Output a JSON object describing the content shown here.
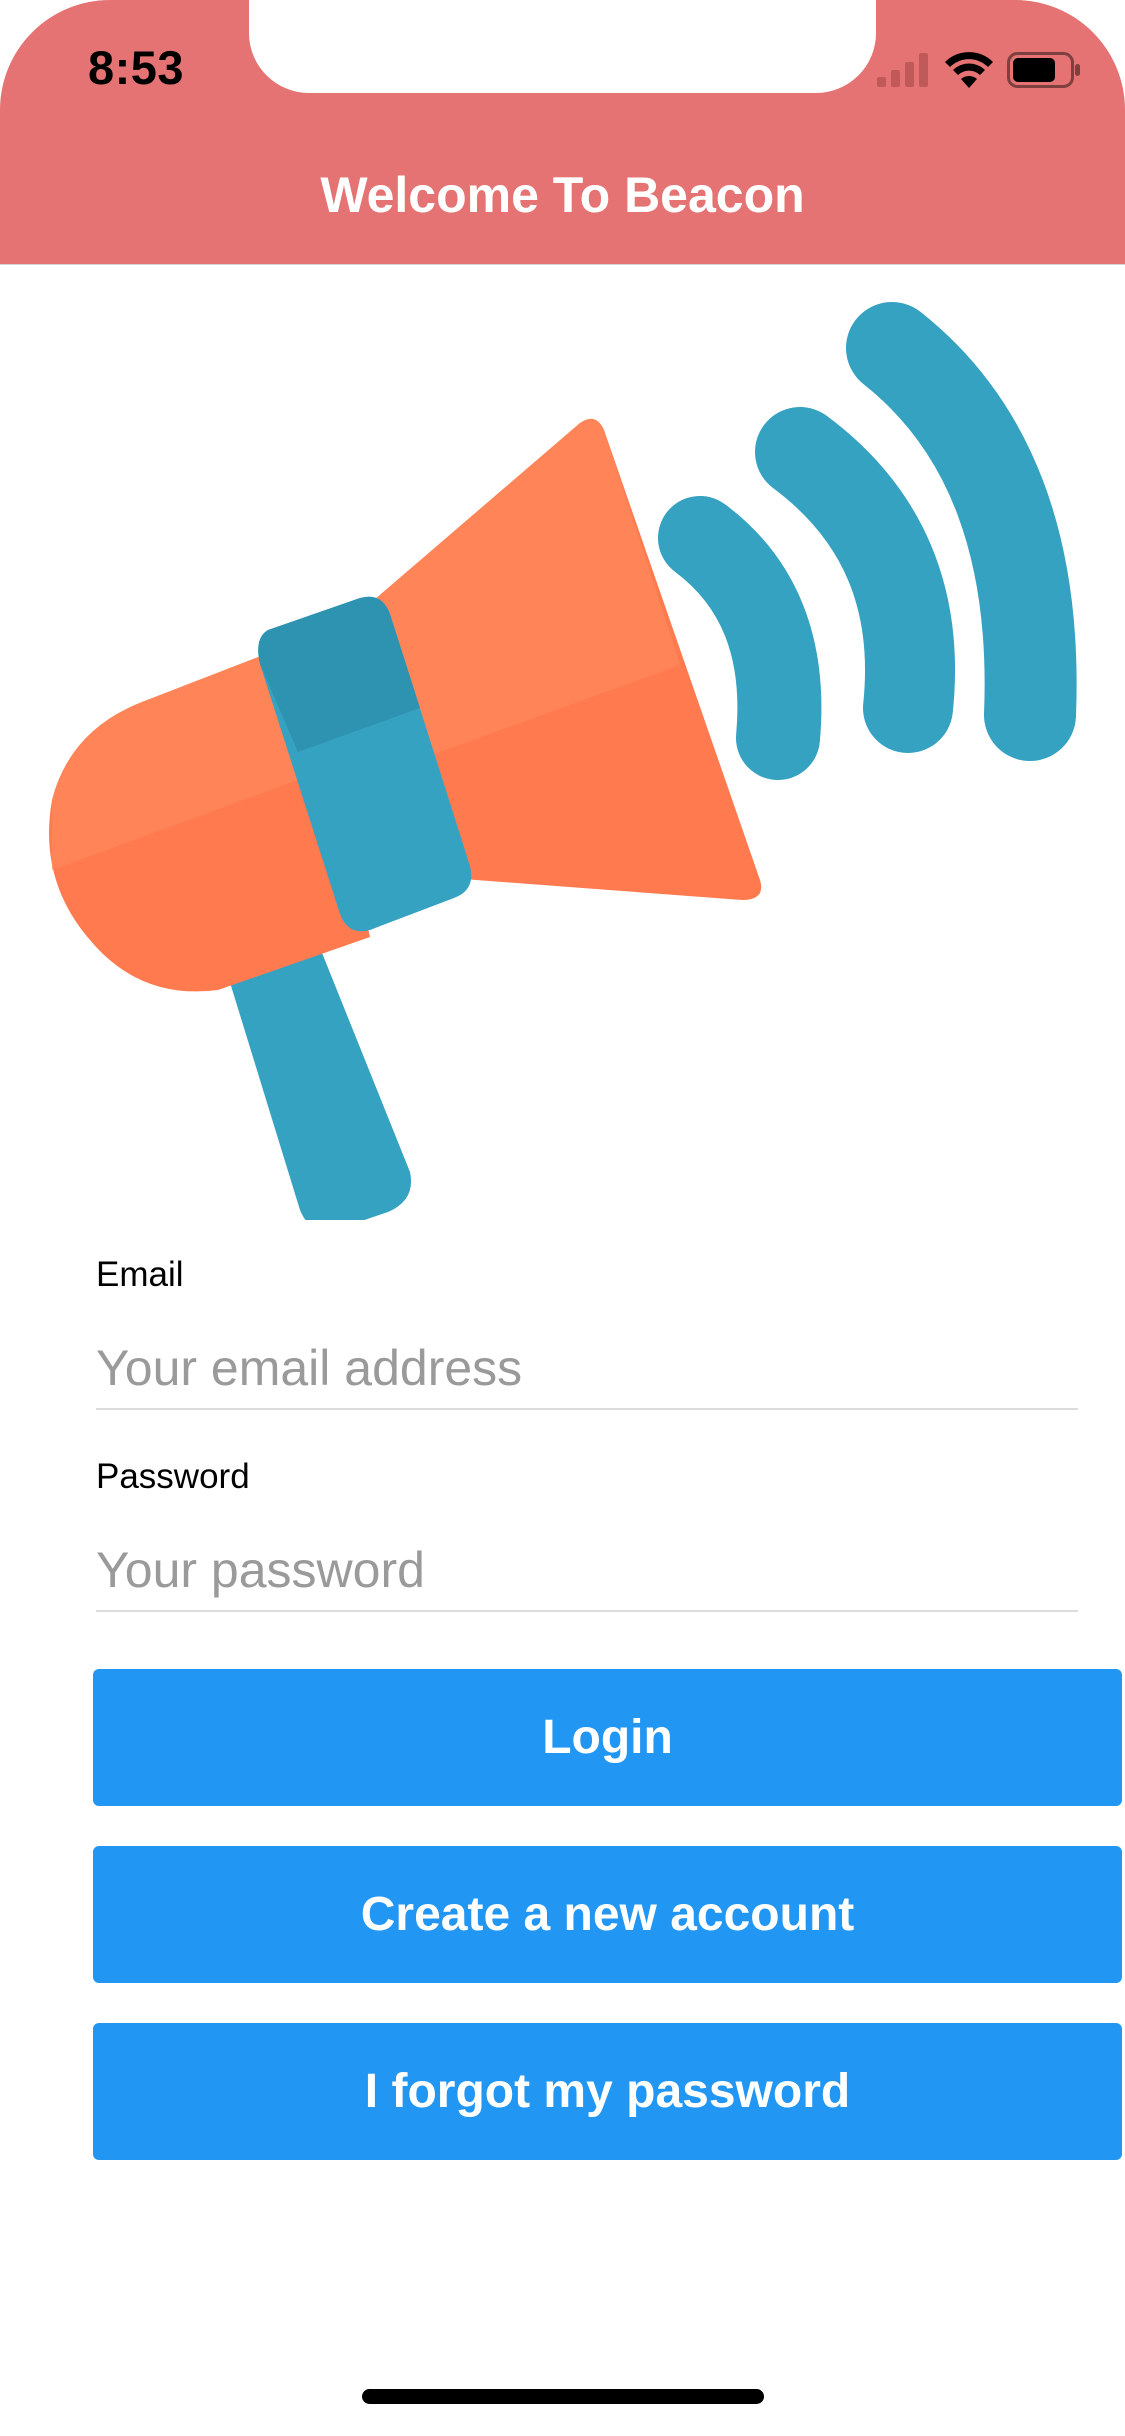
{
  "status_bar": {
    "time": "8:53",
    "icons": [
      "cellular-signal-icon",
      "wifi-icon",
      "battery-icon"
    ]
  },
  "header": {
    "title": "Welcome To Beacon",
    "background": "#e57373"
  },
  "hero": {
    "icon": "megaphone-icon",
    "colors": {
      "body": "#ff7a4f",
      "accent": "#35a2c1"
    }
  },
  "form": {
    "email": {
      "label": "Email",
      "placeholder": "Your email address",
      "value": ""
    },
    "password": {
      "label": "Password",
      "placeholder": "Your password",
      "value": ""
    }
  },
  "buttons": {
    "login": "Login",
    "create_account": "Create a new account",
    "forgot_password": "I forgot my password",
    "color": "#2196f3"
  }
}
